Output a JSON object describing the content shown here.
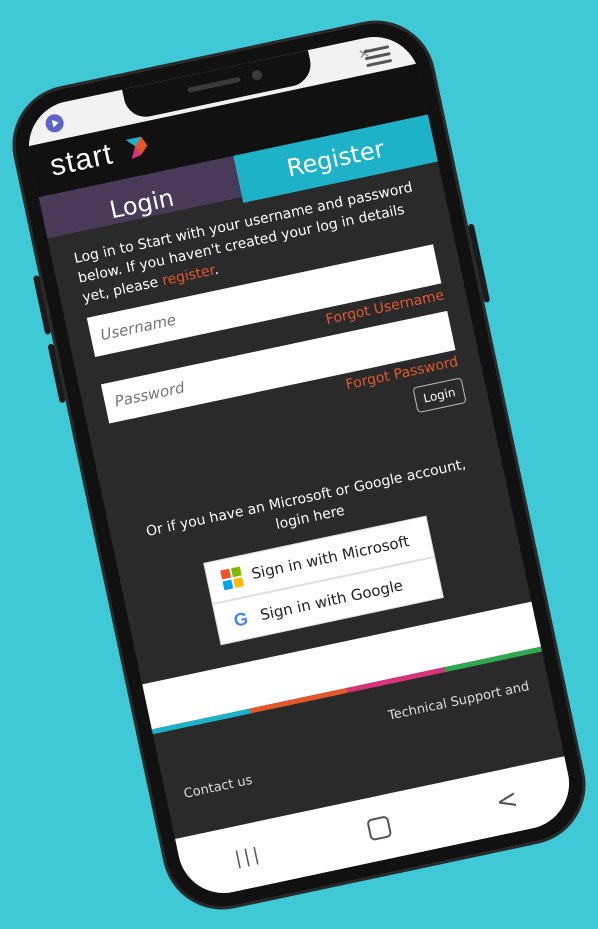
{
  "browser": {
    "close_glyph": "✕"
  },
  "header": {
    "logo_text": "start"
  },
  "tabs": {
    "login": "Login",
    "register": "Register"
  },
  "intro": {
    "text": "Log in to Start with your username and password below. If you haven't created your log in details yet, please ",
    "link": "register",
    "suffix": "."
  },
  "form": {
    "username_placeholder": "Username",
    "password_placeholder": "Password",
    "forgot_username": "Forgot Username",
    "forgot_password": "Forgot Password",
    "login_button": "Login"
  },
  "alt_login": {
    "text": "Or if you have an Microsoft or Google account, login here"
  },
  "sso": {
    "microsoft": "Sign in with Microsoft",
    "google": "Sign in with Google"
  },
  "footer": {
    "support": "Technical Support and",
    "contact": "Contact us"
  },
  "navbar": {
    "recents": "|||",
    "back": "<"
  },
  "colors": {
    "background": "#3fc9d6",
    "register_tab": "#1eb2c8",
    "link": "#e2582b",
    "band": "#4a3a5a",
    "color_bar": [
      "#1eb2c8",
      "#e2582b",
      "#d6337a",
      "#2fa84f"
    ]
  }
}
